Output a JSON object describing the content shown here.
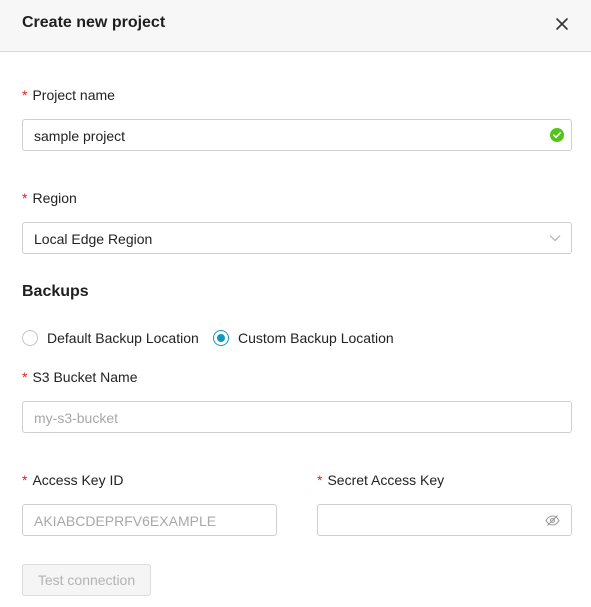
{
  "dialog": {
    "title": "Create new project",
    "close_icon": "close-icon"
  },
  "project_name": {
    "label": "Project name",
    "required_mark": "*",
    "value": "sample project",
    "status_icon": "check-circle-icon",
    "status_color": "#52c41a"
  },
  "region": {
    "label": "Region",
    "required_mark": "*",
    "value": "Local Edge Region",
    "dropdown_icon": "chevron-down-icon"
  },
  "backups": {
    "section_title": "Backups",
    "options": [
      {
        "label": "Default Backup Location",
        "checked": false
      },
      {
        "label": "Custom Backup Location",
        "checked": true
      }
    ],
    "accent_color": "#1696b8"
  },
  "s3_bucket": {
    "label": "S3 Bucket Name",
    "required_mark": "*",
    "placeholder": "my-s3-bucket"
  },
  "access_key": {
    "label": "Access Key ID",
    "required_mark": "*",
    "placeholder": "AKIABCDEPRFV6EXAMPLE"
  },
  "secret_key": {
    "label": "Secret Access Key",
    "required_mark": "*",
    "placeholder": "",
    "visibility_icon": "eye-off-icon"
  },
  "actions": {
    "test_connection_label": "Test connection"
  }
}
